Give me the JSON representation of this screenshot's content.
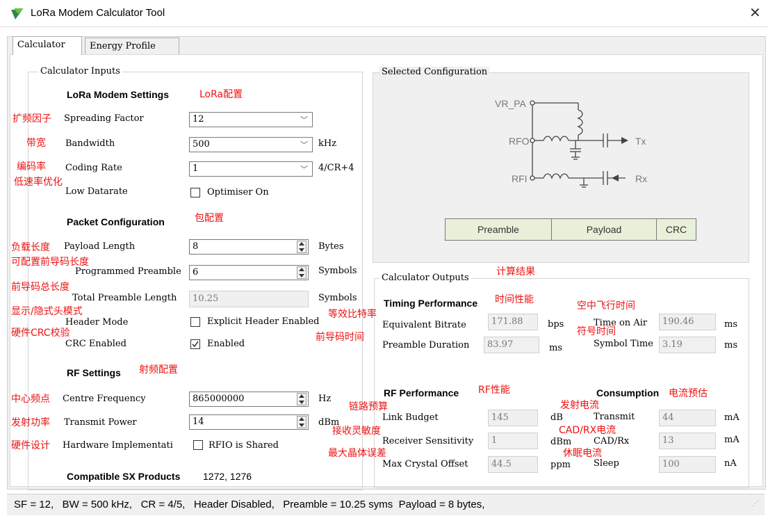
{
  "window": {
    "title": "LoRa Modem Calculator Tool",
    "close_glyph": "✕",
    "app_icon": "lora-logo-icon"
  },
  "tabs": [
    "Calculator",
    "Energy Profile"
  ],
  "inputs": {
    "group_title": "Calculator Inputs",
    "modem_heading": "LoRa Modem Settings",
    "modem_note": "LoRa配置",
    "sf_label": "Spreading Factor",
    "sf_value": "12",
    "sf_note": "扩频因子",
    "bw_label": "Bandwidth",
    "bw_value": "500",
    "bw_unit": "kHz",
    "bw_note": "带宽",
    "cr_label": "Coding Rate",
    "cr_value": "1",
    "cr_unit": "4/CR+4",
    "cr_note": "编码率",
    "ldr_label": "Low Datarate",
    "ldr_check": "Optimiser On",
    "ldr_note": "低速率优化",
    "packet_heading": "Packet Configuration",
    "packet_note": "包配置",
    "payload_label": "Payload Length",
    "payload_value": "8",
    "payload_unit": "Bytes",
    "payload_note": "负载长度",
    "preamble_label": "Programmed Preamble",
    "preamble_value": "6",
    "preamble_unit": "Symbols",
    "preamble_note": "可配置前导码长度",
    "total_label": "Total Preamble Length",
    "total_value": "10.25",
    "total_unit": "Symbols",
    "total_note": "前导码总长度",
    "header_label": "Header Mode",
    "header_check": "Explicit Header Enabled",
    "header_note": "显示/隐式头模式",
    "crc_label": "CRC Enabled",
    "crc_check": "Enabled",
    "crc_note": "硬件CRC校验",
    "rf_heading": "RF Settings",
    "rf_note": "射频配置",
    "freq_label": "Centre Frequency",
    "freq_value": "865000000",
    "freq_unit": "Hz",
    "freq_note": "中心频点",
    "power_label": "Transmit Power",
    "power_value": "14",
    "power_unit": "dBm",
    "power_note": "发射功率",
    "hw_label": "Hardware Implementati",
    "hw_check": "RFIO is Shared",
    "hw_note": "硬件设计",
    "compat_label": "Compatible SX Products",
    "compat_value": "1272, 1276"
  },
  "config": {
    "group_title": "Selected Configuration",
    "vr_pa": "VR_PA",
    "rfo": "RFO",
    "rfi": "RFI",
    "tx": "Tx",
    "rx": "Rx",
    "packet": [
      "Preamble",
      "Payload",
      "CRC"
    ]
  },
  "outputs": {
    "group_title": "Calculator Outputs",
    "group_note": "计算结果",
    "timing_heading": "Timing Performance",
    "timing_note": "时间性能",
    "eq_label": "Equivalent Bitrate",
    "eq_value": "171.88",
    "eq_unit": "bps",
    "eq_note": "等效比特率",
    "pd_label": "Preamble Duration",
    "pd_value": "83.97",
    "pd_unit": "ms",
    "pd_note": "前导码时间",
    "toa_label": "Time on Air",
    "toa_value": "190.46",
    "toa_unit": "ms",
    "toa_note": "空中飞行时间",
    "st_label": "Symbol Time",
    "st_value": "3.19",
    "st_unit": "ms",
    "st_note": "符号时间",
    "rf_heading": "RF Performance",
    "rf_note": "RF性能",
    "lb_label": "Link Budget",
    "lb_value": "145",
    "lb_unit": "dB",
    "lb_note": "链路预算",
    "rs_label": "Receiver Sensitivity",
    "rs_value": "1",
    "rs_unit": "dBm",
    "rs_note": "接收灵敏度",
    "mco_label": "Max Crystal Offset",
    "mco_value": "44.5",
    "mco_unit": "ppm",
    "mco_note": "最大晶体误差",
    "cons_heading": "Consumption",
    "cons_note": "电流预估",
    "tx_label": "Transmit",
    "tx_value": "44",
    "tx_unit": "mA",
    "tx_note": "发射电流",
    "cad_label": "CAD/Rx",
    "cad_value": "13",
    "cad_unit": "mA",
    "cad_note": "CAD/RX电流",
    "sleep_label": "Sleep",
    "sleep_value": "100",
    "sleep_unit": "nA",
    "sleep_note": "休眠电流"
  },
  "status": "SF = 12,   BW = 500 kHz,   CR = 4/5,   Header Disabled,   Preamble = 10.25 syms  Payload = 8 bytes,"
}
